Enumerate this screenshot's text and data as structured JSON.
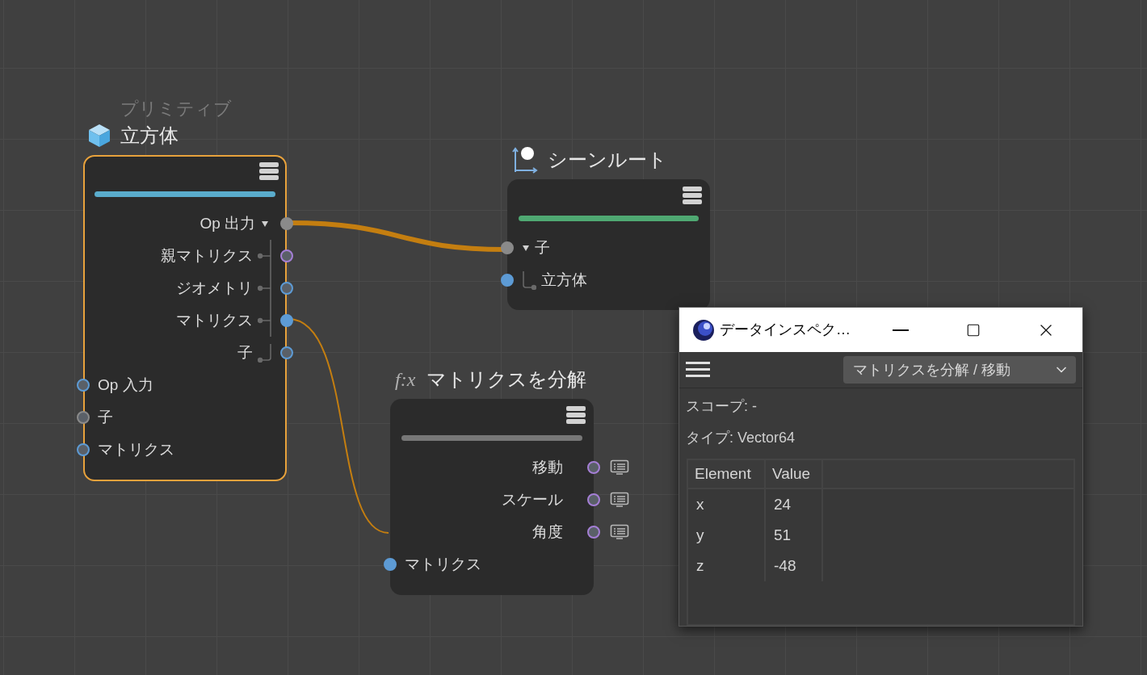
{
  "nodes": [
    {
      "kind": "primitive",
      "category": "プリミティブ",
      "title": "立方体",
      "selected": true,
      "color": "#5aaccc",
      "outputs": [
        {
          "label": "Op 出力",
          "color": "#8a8a8a",
          "connected": true,
          "expanded": true,
          "children": [
            {
              "label": "親マトリクス",
              "color": "#a57fd6",
              "connected": false
            },
            {
              "label": "ジオメトリ",
              "color": "#5d9bd5",
              "connected": false
            },
            {
              "label": "マトリクス",
              "color": "#5d9bd5",
              "connected": true
            },
            {
              "label": "子",
              "color": "#5d9bd5",
              "connected": false
            }
          ]
        }
      ],
      "inputs": [
        {
          "label": "Op 入力",
          "color": "#5d9bd5",
          "connected": false
        },
        {
          "label": "子",
          "color": "#8a8a8a",
          "connected": false
        },
        {
          "label": "マトリクス",
          "color": "#5d9bd5",
          "connected": false
        }
      ]
    },
    {
      "kind": "scene",
      "title": "シーンルート",
      "selected": false,
      "color": "#4fa872",
      "inputs": [
        {
          "label": "子",
          "color": "#8a8a8a",
          "connected": true,
          "expanded": true,
          "children": [
            {
              "label": "立方体",
              "color": "#5d9bd5",
              "connected": true
            }
          ]
        }
      ]
    },
    {
      "kind": "function",
      "badge": "f:x",
      "title": "マトリクスを分解",
      "selected": false,
      "color": "#777777",
      "outputs": [
        {
          "label": "移動",
          "color": "#a57fd6",
          "connected": false,
          "inspect": true
        },
        {
          "label": "スケール",
          "color": "#a57fd6",
          "connected": false,
          "inspect": true
        },
        {
          "label": "角度",
          "color": "#a57fd6",
          "connected": false,
          "inspect": true
        }
      ],
      "inputs": [
        {
          "label": "マトリクス",
          "color": "#5d9bd5",
          "connected": true
        }
      ]
    }
  ],
  "inspector": {
    "title": "データインスペク…",
    "dropdown": "マトリクスを分解 / 移動",
    "scope": "スコープ: -",
    "type": "タイプ: Vector64",
    "table": {
      "columns": [
        "Element",
        "Value"
      ],
      "rows": [
        [
          "x",
          "24"
        ],
        [
          "y",
          "51"
        ],
        [
          "z",
          "-48"
        ]
      ]
    }
  }
}
